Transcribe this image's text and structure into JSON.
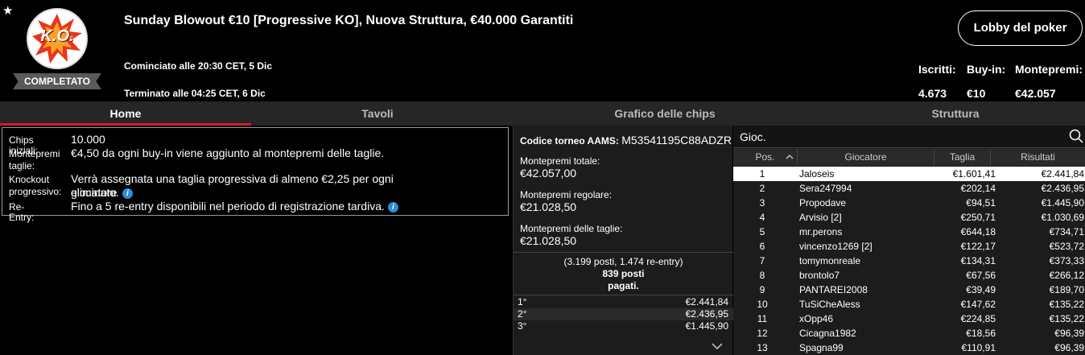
{
  "header": {
    "title": "Sunday Blowout €10 [Progressive KO], Nuova Struttura, €40.000 Garantiti",
    "logo_text": "K.O.",
    "status_badge": "COMPLETATO",
    "started": "Cominciato alle 20:30 CET, 5 Dic",
    "ended": "Terminato alle 04:25 CET, 6 Dic",
    "lobby_button": "Lobby del poker",
    "stats": {
      "iscritti_label": "Iscritti:",
      "iscritti_value": "4.673",
      "buyin_label": "Buy-in:",
      "buyin_value": "€10",
      "montepremi_label": "Montepremi:",
      "montepremi_value": "€42.057"
    },
    "accent_color": "#d01e26"
  },
  "tabs": [
    {
      "label": "Home",
      "active": true
    },
    {
      "label": "Tavoli",
      "active": false
    },
    {
      "label": "Grafico delle chips",
      "active": false
    },
    {
      "label": "Struttura",
      "active": false
    }
  ],
  "info": {
    "chips_label": "Chips iniziali:",
    "chips_value": "10.000",
    "montepremi_label_1": "Montepremi",
    "montepremi_label_2": "taglie:",
    "montepremi_value": "€4,50 da ogni buy-in viene aggiunto al montepremi delle taglie.",
    "knockout_label_1": "Knockout",
    "knockout_label_2": "progressivo:",
    "knockout_value_1": "Verrà assegnata una taglia progressiva di almeno €2,25 per ogni giocatore",
    "knockout_value_2": "eliminato.",
    "reentry_label": "Re-Entry:",
    "reentry_value": "Fino a 5 re-entry disponibili nel periodo di registrazione tardiva.",
    "info_icon": "i"
  },
  "middle": {
    "aams_label": "Codice torneo AAMS:",
    "aams_code": "M53541195C88ADZR",
    "total_label": "Montepremi totale:",
    "total_value": "€42.057,00",
    "regular_label": "Montepremi regolare:",
    "regular_value": "€21.028,50",
    "bounty_label": "Montepremi delle taglie:",
    "bounty_value": "€21.028,50",
    "places_line1": "(3.199 posti, 1.474 re-entry)",
    "places_line2": "839 posti",
    "places_line3": "pagati.",
    "prizes": [
      {
        "pos": "1°",
        "amount": "€2.441,84"
      },
      {
        "pos": "2°",
        "amount": "€2.436,95"
      },
      {
        "pos": "3°",
        "amount": "€1.445,90"
      }
    ]
  },
  "players": {
    "search_placeholder": "Gioc.",
    "columns": {
      "pos": "Pos.",
      "player": "Giocatore",
      "bounty": "Taglia",
      "results": "Risultati"
    },
    "rows": [
      {
        "pos": "1",
        "name": "Jaloseis",
        "bounty": "€1.601,41",
        "result": "€2.441,84"
      },
      {
        "pos": "2",
        "name": "Sera247994",
        "bounty": "€202,14",
        "result": "€2.436,95"
      },
      {
        "pos": "3",
        "name": "Propodave",
        "bounty": "€94,51",
        "result": "€1.445,90"
      },
      {
        "pos": "4",
        "name": "Arvisio [2]",
        "bounty": "€250,71",
        "result": "€1.030,69"
      },
      {
        "pos": "5",
        "name": "mr.perons",
        "bounty": "€644,18",
        "result": "€734,71"
      },
      {
        "pos": "6",
        "name": "vincenzo1269 [2]",
        "bounty": "€122,17",
        "result": "€523,72"
      },
      {
        "pos": "7",
        "name": "tomymonreale",
        "bounty": "€134,31",
        "result": "€373,33"
      },
      {
        "pos": "8",
        "name": "brontolo7",
        "bounty": "€67,56",
        "result": "€266,12"
      },
      {
        "pos": "9",
        "name": "PANTAREI2008",
        "bounty": "€39,49",
        "result": "€189,70"
      },
      {
        "pos": "10",
        "name": "TuSiCheAless",
        "bounty": "€147,62",
        "result": "€135,22"
      },
      {
        "pos": "11",
        "name": "xOpp46",
        "bounty": "€224,85",
        "result": "€135,22"
      },
      {
        "pos": "12",
        "name": "Cicagna1982",
        "bounty": "€18,56",
        "result": "€96,39"
      },
      {
        "pos": "13",
        "name": "Spagna99",
        "bounty": "€110,91",
        "result": "€96,39"
      }
    ]
  }
}
